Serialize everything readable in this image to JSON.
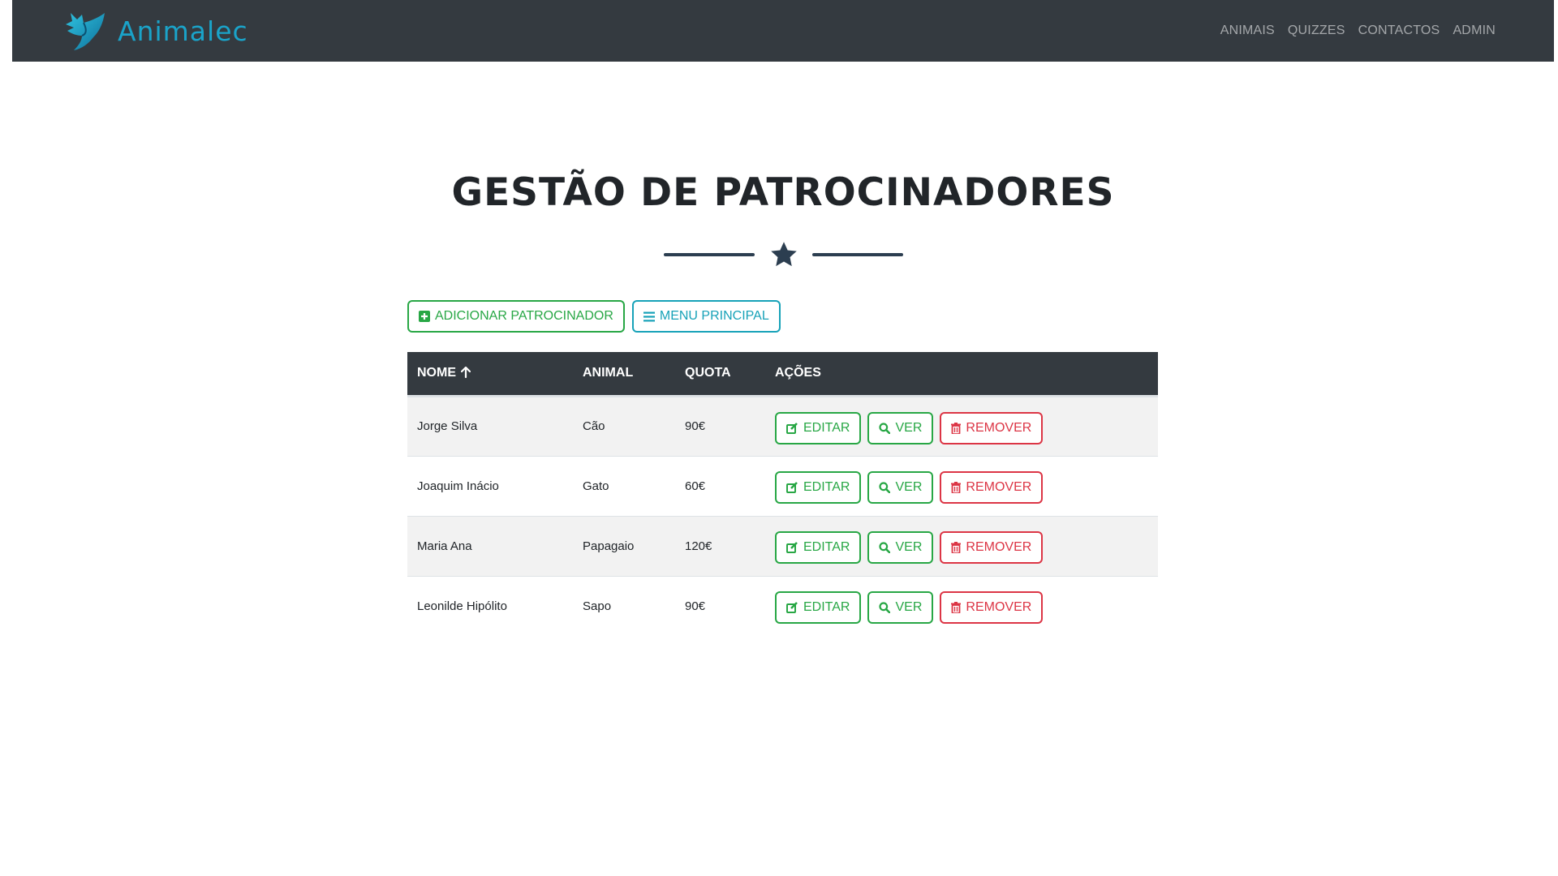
{
  "brand": {
    "name": "Animalec",
    "color": "#1aa3c9"
  },
  "nav": {
    "items": [
      {
        "label": "ANIMAIS"
      },
      {
        "label": "QUIZZES"
      },
      {
        "label": "CONTACTOS"
      },
      {
        "label": "ADMIN"
      }
    ]
  },
  "page": {
    "title": "GESTÃO DE PATROCINADORES",
    "divider_icon": "star-icon"
  },
  "toolbar": {
    "add_label": "ADICIONAR PATROCINADOR",
    "add_icon": "plus-square-icon",
    "menu_label": "MENU PRINCIPAL",
    "menu_icon": "bars-icon"
  },
  "table": {
    "headers": {
      "name": "NOME",
      "animal": "ANIMAL",
      "quota": "QUOTA",
      "actions": "AÇÕES"
    },
    "sort_icon": "arrow-up-icon",
    "rows": [
      {
        "name": "Jorge Silva",
        "animal": "Cão",
        "quota": "90€"
      },
      {
        "name": "Joaquim Inácio",
        "animal": "Gato",
        "quota": "60€"
      },
      {
        "name": "Maria Ana",
        "animal": "Papagaio",
        "quota": "120€"
      },
      {
        "name": "Leonilde Hipólito",
        "animal": "Sapo",
        "quota": "90€"
      }
    ],
    "actions": {
      "edit_label": "EDITAR",
      "view_label": "VER",
      "remove_label": "REMOVER"
    }
  },
  "colors": {
    "navbar": "#343a40",
    "success": "#28a745",
    "info": "#17a2b8",
    "danger": "#dc3545",
    "divider": "#2c3e50"
  }
}
